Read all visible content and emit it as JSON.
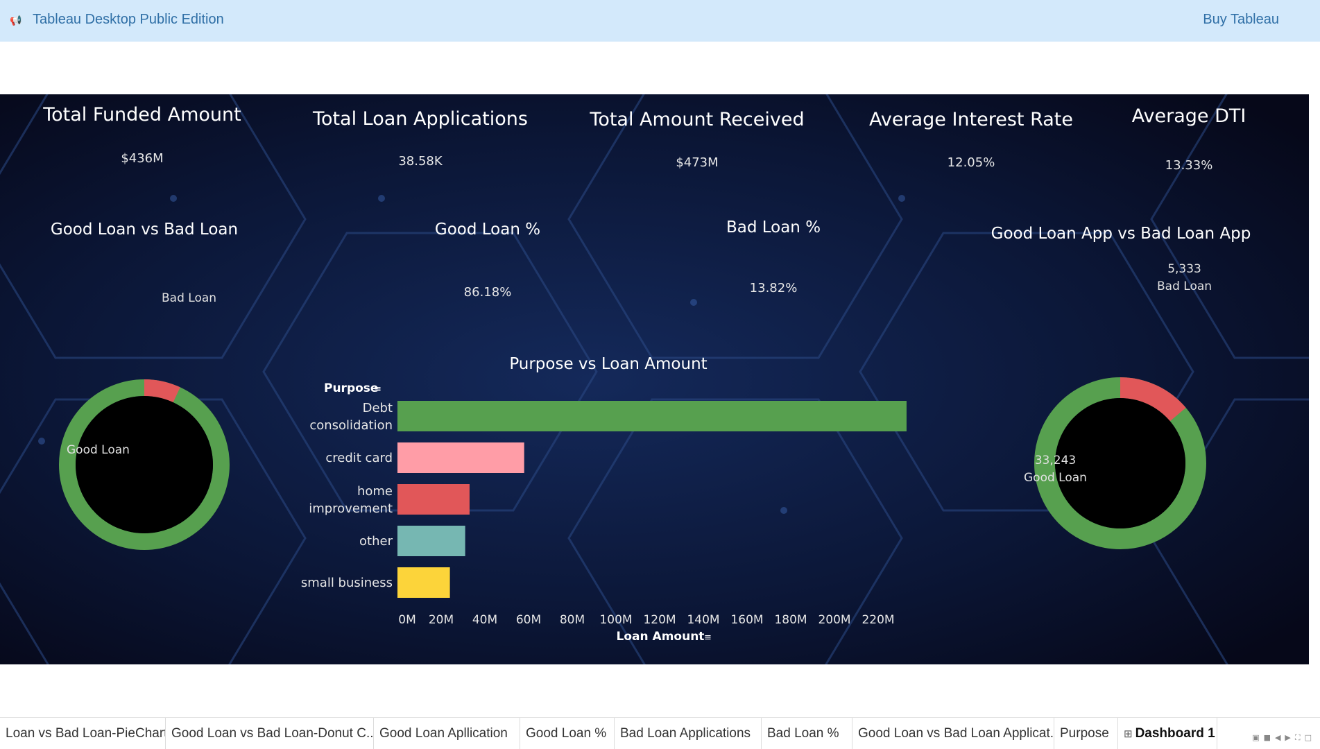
{
  "header": {
    "app_title": "Tableau Desktop Public Edition",
    "buy_label": "Buy Tableau"
  },
  "kpis": [
    {
      "title": "Total Funded Amount",
      "value": "$436M"
    },
    {
      "title": "Total Loan Applications",
      "value": "38.58K"
    },
    {
      "title": "Total Amount Received",
      "value": "$473M"
    },
    {
      "title": "Average Interest Rate",
      "value": "12.05%"
    },
    {
      "title": "Average DTI",
      "value": "13.33%"
    }
  ],
  "good_bad_loan": {
    "title": "Good Loan vs Bad Loan",
    "bad_label": "Bad Loan",
    "good_label": "Good Loan",
    "bad_fraction": 0.0691,
    "colors": {
      "good": "#57a04f",
      "bad": "#e15759",
      "hole": "#000000"
    }
  },
  "good_loan_pct": {
    "title": "Good Loan %",
    "value": "86.18%"
  },
  "bad_loan_pct": {
    "title": "Bad Loan %",
    "value": "13.82%"
  },
  "good_bad_app": {
    "title": "Good Loan App vs Bad Loan App",
    "bad_value": "5,333",
    "bad_label": "Bad Loan",
    "good_value": "33,243",
    "good_label": "Good Loan",
    "bad_fraction": 0.1382
  },
  "chart_data": {
    "type": "bar",
    "orientation": "horizontal",
    "title": "Purpose vs Loan Amount",
    "ylabel": "Purpose",
    "xlabel": "Loan Amount",
    "categories": [
      "Debt consolidation",
      "credit card",
      "home improvement",
      "other",
      "small business"
    ],
    "values": [
      233,
      58,
      33,
      31,
      24
    ],
    "colors": [
      "#57a04f",
      "#ff9da7",
      "#e15759",
      "#76b7b2",
      "#fcd43a"
    ],
    "xlim": [
      0,
      233
    ],
    "xticks": [
      "0M",
      "20M",
      "40M",
      "60M",
      "80M",
      "100M",
      "120M",
      "140M",
      "160M",
      "180M",
      "200M",
      "220M"
    ],
    "grid": false,
    "legend": "none"
  },
  "tabs": [
    {
      "label": "Loan vs Bad Loan-PieChart",
      "active": false
    },
    {
      "label": "Good Loan vs Bad Loan-Donut C...",
      "active": false
    },
    {
      "label": "Good Loan Apllication",
      "active": false
    },
    {
      "label": "Good Loan %",
      "active": false
    },
    {
      "label": "Bad Loan Applications",
      "active": false
    },
    {
      "label": "Bad Loan %",
      "active": false
    },
    {
      "label": "Good Loan vs Bad Loan Applicat...",
      "active": false
    },
    {
      "label": "Purpose",
      "active": false
    },
    {
      "label": "Dashboard 1",
      "active": true
    }
  ]
}
